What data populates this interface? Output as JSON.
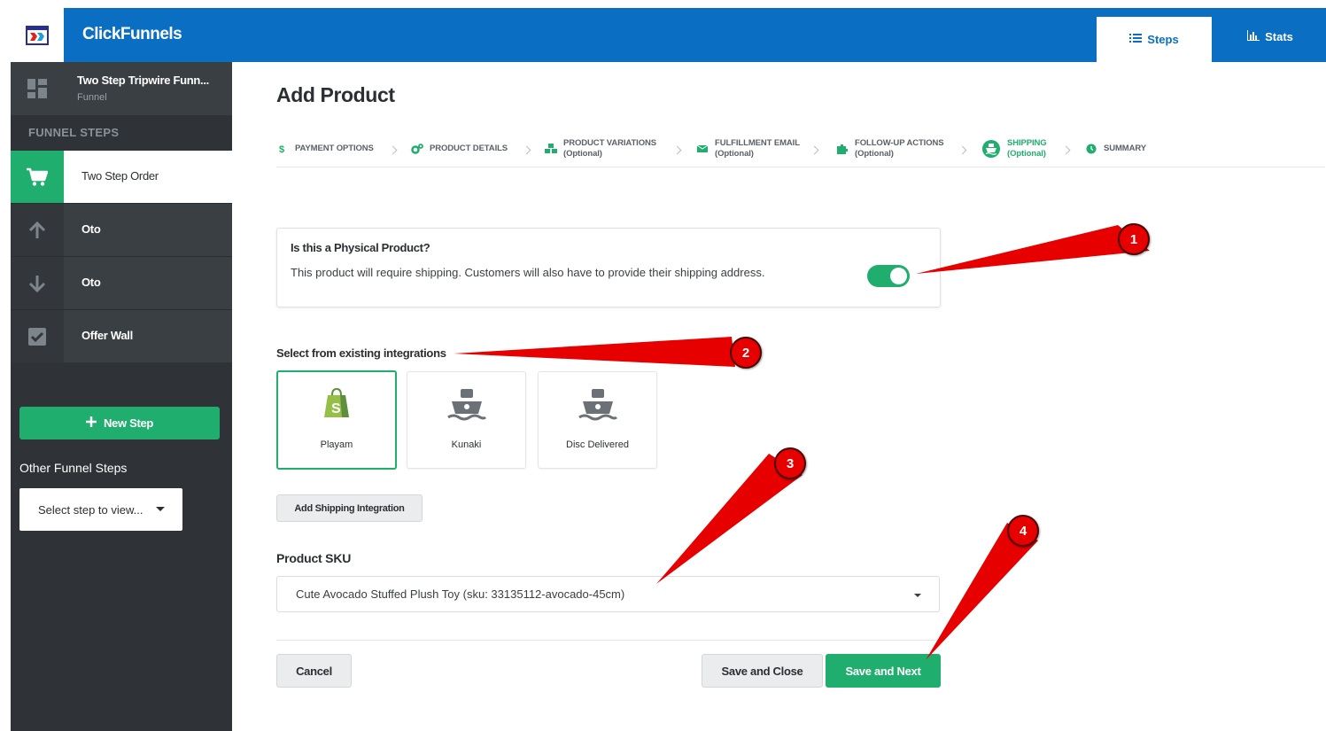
{
  "header": {
    "app_title": "ClickFunnels",
    "tabs": [
      {
        "label": "Steps",
        "icon": "list-icon",
        "active": true
      },
      {
        "label": "Stats",
        "icon": "bar-chart-icon",
        "active": false
      }
    ],
    "color": "#0a6fc2"
  },
  "sidebar": {
    "funnel_name": "Two Step Tripwire Funn...",
    "funnel_type": "Funnel",
    "section_label": "FUNNEL STEPS",
    "steps": [
      {
        "label": "Two Step Order",
        "icon": "cart-icon",
        "active": true
      },
      {
        "label": "Oto",
        "icon": "arrow-up-icon",
        "active": false
      },
      {
        "label": "Oto",
        "icon": "arrow-down-icon",
        "active": false
      },
      {
        "label": "Offer Wall",
        "icon": "checkbox-icon",
        "active": false
      }
    ],
    "new_step_label": "New Step",
    "other_steps_label": "Other Funnel Steps",
    "select_placeholder": "Select step to view..."
  },
  "main": {
    "title": "Add Product",
    "wizard": [
      {
        "label": "PAYMENT OPTIONS",
        "optional": "",
        "icon": "dollar-icon"
      },
      {
        "label": "PRODUCT DETAILS",
        "optional": "",
        "icon": "cogs-icon"
      },
      {
        "label": "PRODUCT VARIATIONS",
        "optional": "(Optional)",
        "icon": "cubes-icon"
      },
      {
        "label": "FULFILLMENT EMAIL",
        "optional": "(Optional)",
        "icon": "envelope-icon"
      },
      {
        "label": "FOLLOW-UP ACTIONS",
        "optional": "(Optional)",
        "icon": "puzzle-icon"
      },
      {
        "label": "SHIPPING",
        "optional": "(Optional)",
        "icon": "ship-icon",
        "active": true
      },
      {
        "label": "SUMMARY",
        "optional": "",
        "icon": "clock-icon"
      }
    ],
    "physical": {
      "title": "Is this a Physical Product?",
      "text": "This product will require shipping. Customers will also have to provide their shipping address.",
      "enabled": true
    },
    "integrations_label": "Select from existing integrations",
    "integrations": [
      {
        "name": "Playam",
        "icon": "shopify-icon",
        "selected": true
      },
      {
        "name": "Kunaki",
        "icon": "ship-icon",
        "selected": false
      },
      {
        "name": "Disc Delivered",
        "icon": "ship-icon",
        "selected": false
      }
    ],
    "add_integration_label": "Add Shipping Integration",
    "sku_label": "Product SKU",
    "sku_value": "Cute Avocado Stuffed Plush Toy (sku: 33135112-avocado-45cm)",
    "cancel_label": "Cancel",
    "save_close_label": "Save and Close",
    "save_next_label": "Save and Next",
    "accent": "#1fae6e"
  },
  "annotations": {
    "badges": [
      "1",
      "2",
      "3",
      "4"
    ],
    "color": "#e60000"
  }
}
